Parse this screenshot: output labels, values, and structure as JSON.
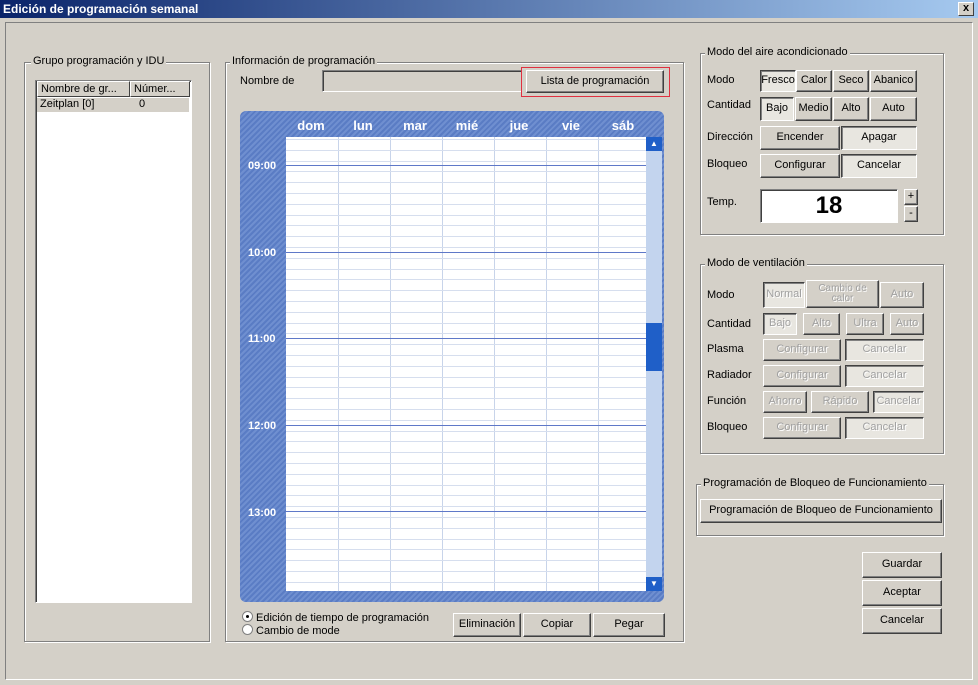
{
  "window": {
    "title": "Edición de programación semanal",
    "close": "x"
  },
  "group": {
    "title": "Grupo  programación y IDU",
    "columns": [
      "Nombre de gr...",
      "Númer..."
    ],
    "rows": [
      {
        "name": "Zeitplan [0]",
        "number": "0"
      }
    ]
  },
  "info": {
    "title": "Información de programación",
    "name_label": "Nombre de",
    "name_value": "",
    "list_button": "Lista de programación",
    "days": [
      "dom",
      "lun",
      "mar",
      "mié",
      "jue",
      "vie",
      "sáb"
    ],
    "times": [
      "09:00",
      "10:00",
      "11:00",
      "12:00",
      "13:00"
    ],
    "radio_edit": "Edición de tiempo de programación",
    "radio_mode": "Cambio de mode",
    "delete": "Eliminación",
    "copy": "Copiar",
    "paste": "Pegar"
  },
  "ac": {
    "title": "Modo del aire acondicionado",
    "mode_label": "Modo",
    "modes": [
      "Fresco",
      "Calor",
      "Seco",
      "Abanico"
    ],
    "amount_label": "Cantidad",
    "amounts": [
      "Bajo",
      "Medio",
      "Alto",
      "Auto"
    ],
    "direction_label": "Dirección",
    "direction_on": "Encender",
    "direction_off": "Apagar",
    "lock_label": "Bloqueo",
    "lock_set": "Configurar",
    "lock_cancel": "Cancelar",
    "temp_label": "Temp.",
    "temp_value": "18",
    "temp_up": "+",
    "temp_down": "-"
  },
  "vent": {
    "title": "Modo de ventilación",
    "mode_label": "Modo",
    "modes": [
      "Normal",
      "Cambio de calor",
      "Auto"
    ],
    "amount_label": "Cantidad",
    "amounts": [
      "Bajo",
      "Alto",
      "Ultra",
      "Auto"
    ],
    "plasma_label": "Plasma",
    "plasma_set": "Configurar",
    "plasma_cancel": "Cancelar",
    "radiator_label": "Radiador",
    "radiator_set": "Configurar",
    "radiator_cancel": "Cancelar",
    "function_label": "Función",
    "functions": [
      "Ahorro",
      "Rápido",
      "Cancelar"
    ],
    "lock_label": "Bloqueo",
    "lock_set": "Configurar",
    "lock_cancel": "Cancelar"
  },
  "oplock": {
    "title": "Programación de Bloqueo de Funcionamiento",
    "button": "Programación de Bloqueo de Funcionamiento"
  },
  "actions": {
    "save": "Guardar",
    "accept": "Aceptar",
    "cancel": "Cancelar"
  },
  "colors": {
    "calendar": "#5a7cc4",
    "highlight": "#e03040",
    "scroll_thumb": "#1f5fc8"
  }
}
